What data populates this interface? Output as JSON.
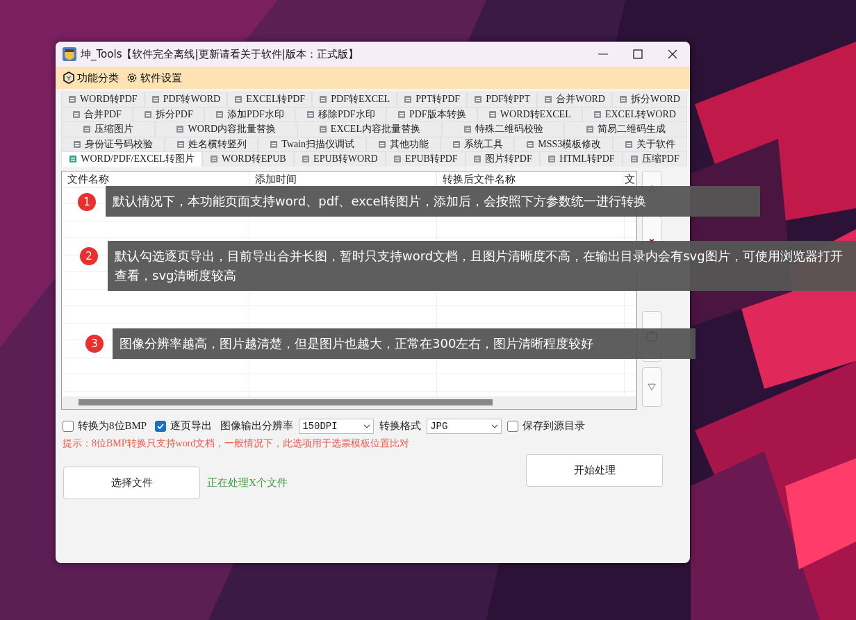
{
  "window": {
    "title": "坤_Tools【软件完全离线|更新请看关于软件|版本：正式版】"
  },
  "menu": [
    {
      "label": "功能分类"
    },
    {
      "label": "软件设置"
    }
  ],
  "tab_rows": [
    [
      {
        "label": "WORD转PDF",
        "selected": false
      },
      {
        "label": "PDF转WORD",
        "selected": false
      },
      {
        "label": "EXCEL转PDF",
        "selected": false
      },
      {
        "label": "PDF转EXCEL",
        "selected": false
      },
      {
        "label": "PPT转PDF",
        "selected": false
      },
      {
        "label": "PDF转PPT",
        "selected": false
      },
      {
        "label": "合并WORD",
        "selected": false
      },
      {
        "label": "拆分WORD",
        "selected": false
      }
    ],
    [
      {
        "label": "合并PDF",
        "selected": false
      },
      {
        "label": "拆分PDF",
        "selected": false
      },
      {
        "label": "添加PDF水印",
        "selected": false
      },
      {
        "label": "移除PDF水印",
        "selected": false
      },
      {
        "label": "PDF版本转换",
        "selected": false
      },
      {
        "label": "WORD转EXCEL",
        "selected": false
      },
      {
        "label": "EXCEL转WORD",
        "selected": false
      }
    ],
    [
      {
        "label": "压缩图片",
        "selected": false
      },
      {
        "label": "WORD内容批量替换",
        "selected": false
      },
      {
        "label": "EXCEL内容批量替换",
        "selected": false
      },
      {
        "label": "特殊二维码校验",
        "selected": false
      },
      {
        "label": "简易二维码生成",
        "selected": false
      }
    ],
    [
      {
        "label": "身份证号码校验",
        "selected": false
      },
      {
        "label": "姓名横转竖列",
        "selected": false
      },
      {
        "label": "Twain扫描仪调试",
        "selected": false
      },
      {
        "label": "其他功能",
        "selected": false
      },
      {
        "label": "系统工具",
        "selected": false
      },
      {
        "label": "MSS3模板修改",
        "selected": false
      },
      {
        "label": "关于软件",
        "selected": false
      }
    ],
    [
      {
        "label": "WORD/PDF/EXCEL转图片",
        "selected": true
      },
      {
        "label": "WORD转EPUB",
        "selected": false
      },
      {
        "label": "EPUB转WORD",
        "selected": false
      },
      {
        "label": "EPUB转PDF",
        "selected": false
      },
      {
        "label": "图片转PDF",
        "selected": false
      },
      {
        "label": "HTML转PDF",
        "selected": false
      },
      {
        "label": "压缩PDF",
        "selected": false
      }
    ]
  ],
  "table": {
    "columns": [
      "文件名称",
      "添加时间",
      "转换后文件名称",
      "文"
    ]
  },
  "options": [
    {
      "kind": "checkbox",
      "label": "转换为8位BMP",
      "checked": false
    },
    {
      "kind": "checkbox",
      "label": "逐页导出",
      "checked": true
    },
    {
      "kind": "select",
      "label": "图像输出分辨率",
      "value": "150DPI"
    },
    {
      "kind": "select",
      "label": "转换格式",
      "value": "JPG"
    },
    {
      "kind": "checkbox",
      "label": "保存到源目录",
      "checked": false
    }
  ],
  "hint": "提示：8位BMP转换只支持word文档，一般情况下，此选项用于选票模板位置比对",
  "select_button": "选择文件",
  "status": "正在处理X个文件",
  "start_button": "开始处理",
  "callouts": [
    {
      "number": "1",
      "text": "默认情况下，本功能页面支持word、pdf、excel转图片，添加后，会按照下方参数统一进行转换"
    },
    {
      "number": "2",
      "text": "默认勾选逐页导出，目前导出合并长图，暂时只支持word文档，且图片清晰度不高，在输出目录内会有svg图片，可使用浏览器打开查看，svg清晰度较高"
    },
    {
      "number": "3",
      "text": "图像分辨率越高，图片越清楚，但是图片也越大，正常在300左右，图片清晰程度较好"
    }
  ]
}
